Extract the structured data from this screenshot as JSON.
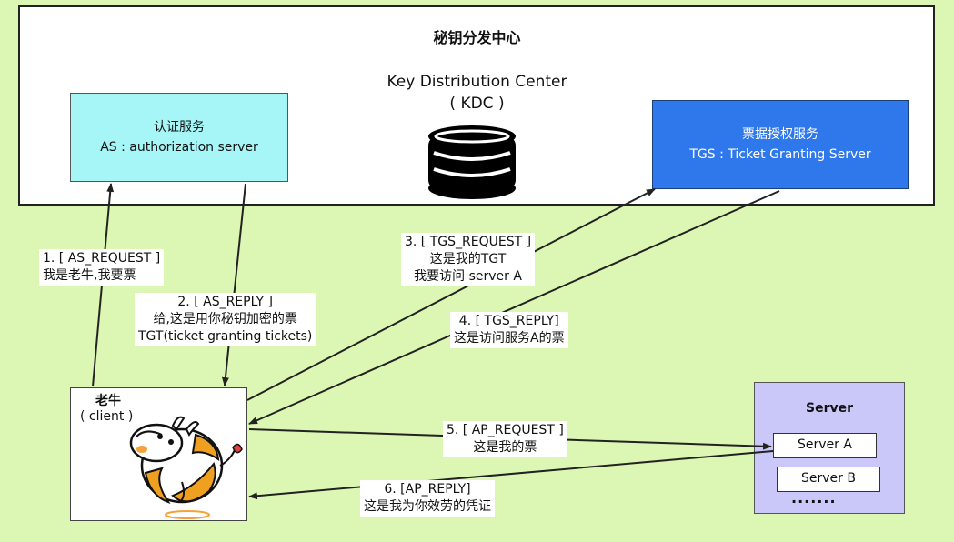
{
  "kdc": {
    "title_cn": "秘钥分发中心",
    "title_en": "Key Distribution Center",
    "abbr": "( KDC )",
    "database_icon": "database-icon"
  },
  "as": {
    "title": "认证服务",
    "subtitle": "AS : authorization server",
    "color": "#a6f5f7"
  },
  "tgs": {
    "title": "票据授权服务",
    "subtitle": "TGS : Ticket Granting Server",
    "color": "#2f78ec"
  },
  "client": {
    "name": "老牛",
    "subtitle": "( client )",
    "icon": "cow-icon"
  },
  "server": {
    "title": "Server",
    "items": [
      "Server A",
      "Server B"
    ],
    "more": "·······",
    "color": "#c9c8f9"
  },
  "steps": [
    {
      "line1": "1. [ AS_REQUEST ]",
      "line2": "我是老牛,我要票"
    },
    {
      "line1": "2. [ AS_REPLY ]",
      "line2": "给,这是用你秘钥加密的票",
      "line3": "TGT(ticket granting tickets)"
    },
    {
      "line1": "3. [ TGS_REQUEST ]",
      "line2": "这是我的TGT",
      "line3": "我要访问 server A"
    },
    {
      "line1": "4. [ TGS_REPLY]",
      "line2": "这是访问服务A的票"
    },
    {
      "line1": "5. [ AP_REQUEST ]",
      "line2": "这是我的票"
    },
    {
      "line1": "6. [AP_REPLY]",
      "line2": "这是我为你效劳的凭证"
    }
  ],
  "background_color": "#dcf7b4"
}
